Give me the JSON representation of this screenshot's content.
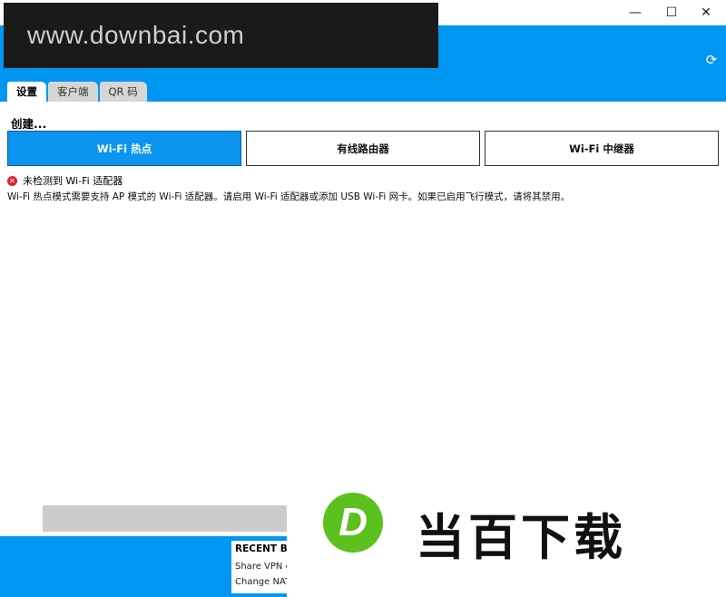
{
  "window": {
    "minimize_icon": "minimize-icon",
    "maximize_icon": "maximize-icon",
    "close_icon": "close-icon"
  },
  "header": {
    "refresh_icon": "refresh-icon",
    "accent_color": "#0097f3"
  },
  "watermark": {
    "site": "www.downbai.com",
    "logo_letter": "D",
    "brand": "当百下载"
  },
  "tabs": [
    {
      "label": "设置",
      "active": true
    },
    {
      "label": "客户端",
      "active": false
    },
    {
      "label": "QR 码",
      "active": false
    }
  ],
  "create": {
    "label": "创建...",
    "modes": [
      {
        "label": "Wi-Fi 热点",
        "active": true
      },
      {
        "label": "有线路由器",
        "active": false
      },
      {
        "label": "Wi-Fi 中继器",
        "active": false
      }
    ]
  },
  "status": {
    "error_title": "未检测到 Wi-Fi 适配器",
    "error_desc": "Wi-Fi 热点模式需要支持 AP 模式的 Wi-Fi 适配器。请启用 Wi-Fi 适配器或添加 USB Wi-Fi 网卡。如果已启用飞行模式，请将其禁用。"
  },
  "recent": {
    "title": "RECENT BL",
    "items": [
      "Share VPN ov",
      "Change NAT"
    ]
  }
}
